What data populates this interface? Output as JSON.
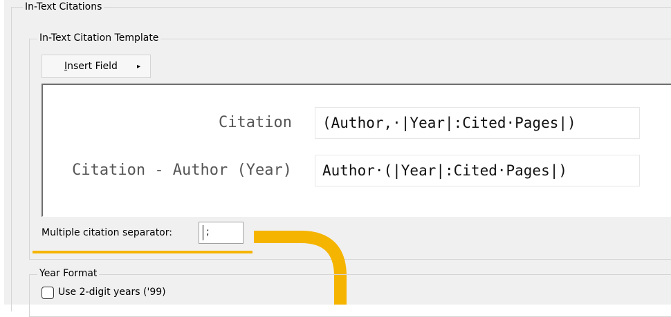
{
  "in_text_citations": {
    "title": "In-Text Citations"
  },
  "template_section": {
    "title": "In-Text Citation Template",
    "insert_field_label": "Insert Field",
    "insert_field_arrow": "▸",
    "rows": [
      {
        "label": "Citation",
        "value": "(Author,·|Year|:Cited·Pages|)"
      },
      {
        "label": "Citation - Author (Year)",
        "value": "Author·(|Year|:Cited·Pages|)"
      }
    ]
  },
  "separator": {
    "label": "Multiple citation separator:",
    "value": ";"
  },
  "year_format": {
    "title": "Year Format",
    "two_digit_label": "Use 2-digit years ('99)",
    "two_digit_checked": false
  },
  "colors": {
    "highlight": "#f5b400",
    "panel_bg": "#f0f0f0"
  }
}
